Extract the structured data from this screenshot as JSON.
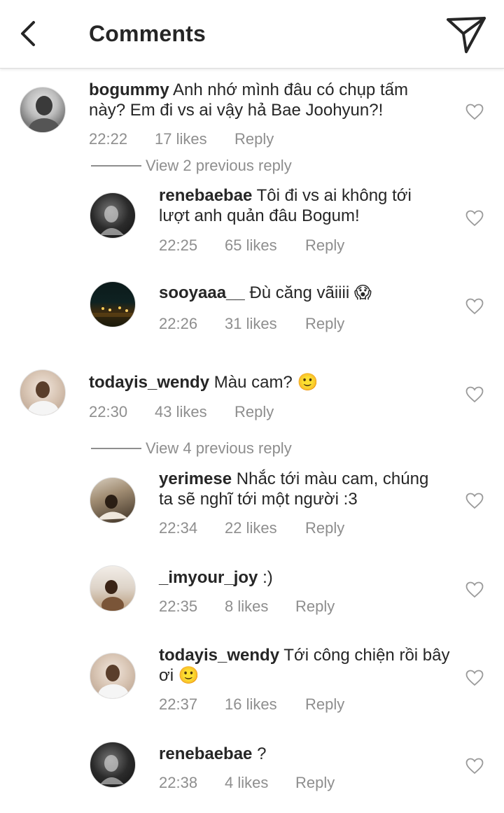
{
  "header": {
    "title": "Comments"
  },
  "comments": [
    {
      "user": "bogummy",
      "text": "Anh nhớ mình đâu có chụp tấm này? Em đi vs ai vậy hả Bae Joohyun?!",
      "time": "22:22",
      "likes": "17 likes",
      "reply": "Reply"
    },
    {
      "user": "renebaebae",
      "text": "Tôi đi vs ai không tới lượt anh quản đâu Bogum!",
      "time": "22:25",
      "likes": "65 likes",
      "reply": "Reply"
    },
    {
      "user": "sooyaaa__",
      "text": "Đù căng vãiiii 😱",
      "time": "22:26",
      "likes": "31 likes",
      "reply": "Reply"
    },
    {
      "user": "todayis_wendy",
      "text": "Màu cam? 🙂",
      "time": "22:30",
      "likes": "43 likes",
      "reply": "Reply"
    },
    {
      "user": "yerimese",
      "text": "Nhắc tới màu cam, chúng ta sẽ nghĩ tới một người :3",
      "time": "22:34",
      "likes": "22 likes",
      "reply": "Reply"
    },
    {
      "user": "_imyour_joy",
      "text": ":)",
      "time": "22:35",
      "likes": "8 likes",
      "reply": "Reply"
    },
    {
      "user": "todayis_wendy",
      "text": "Tới công chiện rồi bây ơi 🙂",
      "time": "22:37",
      "likes": "16 likes",
      "reply": "Reply"
    },
    {
      "user": "renebaebae",
      "text": "?",
      "time": "22:38",
      "likes": "4 likes",
      "reply": "Reply"
    }
  ],
  "view_previous": [
    {
      "label": "View 2 previous reply"
    },
    {
      "label": "View 4 previous reply"
    }
  ],
  "icons": {
    "back": "chevron-left-icon",
    "share": "paper-plane-icon",
    "like": "heart-outline-icon"
  }
}
